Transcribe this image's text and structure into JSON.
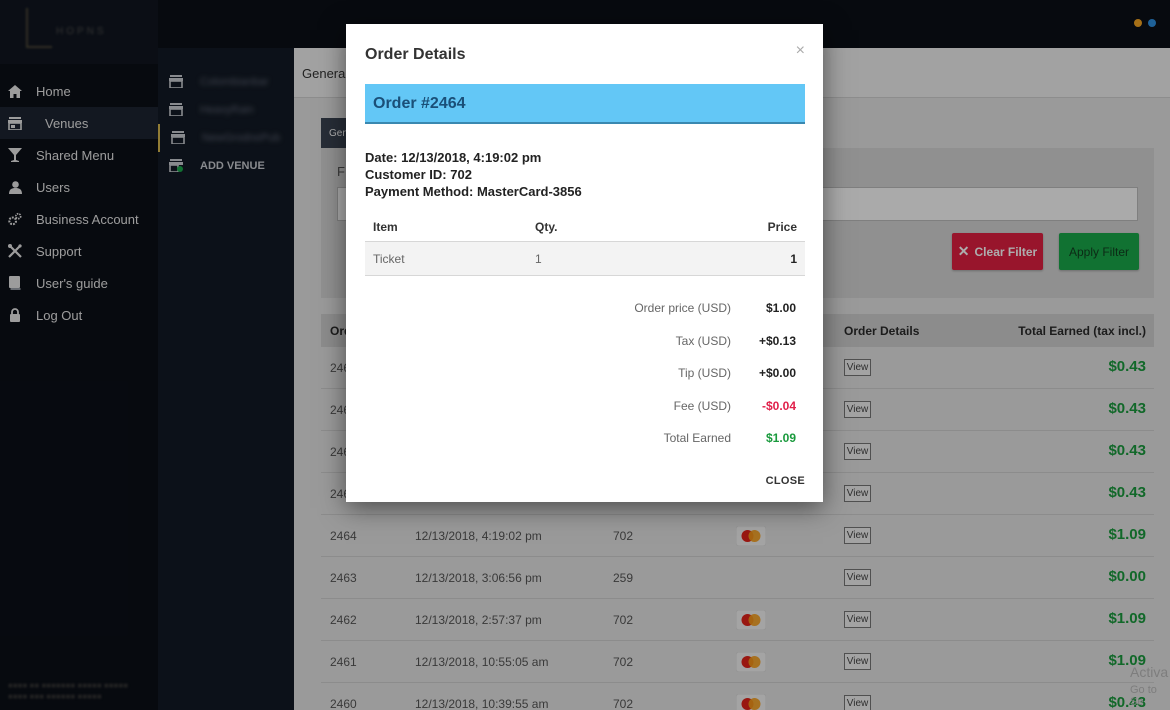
{
  "sidebar": {
    "items": [
      {
        "label": "Home",
        "icon": "home-icon"
      },
      {
        "label": "Venues",
        "icon": "store-icon"
      },
      {
        "label": "Shared Menu",
        "icon": "cocktail-icon"
      },
      {
        "label": "Users",
        "icon": "user-icon"
      },
      {
        "label": "Business Account",
        "icon": "gears-icon"
      },
      {
        "label": "Support",
        "icon": "tools-icon"
      },
      {
        "label": "User's guide",
        "icon": "book-icon"
      },
      {
        "label": "Log Out",
        "icon": "lock-icon"
      }
    ]
  },
  "subnav": {
    "venues": [
      "Colombianbar",
      "HeavyRain",
      "NewGrodnoPub"
    ],
    "add_label": "ADD VENUE"
  },
  "main": {
    "tab_label": "General",
    "tab2_label": "Gen",
    "filter_label": "F",
    "clear_filter_label": "Clear Filter",
    "apply_filter_label": "Apply Filter",
    "table_headers": {
      "order": "Ord",
      "order_details": "Order Details",
      "total_earned": "Total Earned (tax incl.)"
    },
    "rows": [
      {
        "id": "246",
        "date": "",
        "customer": "",
        "mc": false,
        "amount": "$0.43"
      },
      {
        "id": "246",
        "date": "",
        "customer": "",
        "mc": false,
        "amount": "$0.43"
      },
      {
        "id": "246",
        "date": "",
        "customer": "",
        "mc": false,
        "amount": "$0.43"
      },
      {
        "id": "246",
        "date": "",
        "customer": "",
        "mc": false,
        "amount": "$0.43"
      },
      {
        "id": "2464",
        "date": "12/13/2018, 4:19:02 pm",
        "customer": "702",
        "mc": true,
        "amount": "$1.09"
      },
      {
        "id": "2463",
        "date": "12/13/2018, 3:06:56 pm",
        "customer": "259",
        "mc": false,
        "amount": "$0.00"
      },
      {
        "id": "2462",
        "date": "12/13/2018, 2:57:37 pm",
        "customer": "702",
        "mc": true,
        "amount": "$1.09"
      },
      {
        "id": "2461",
        "date": "12/13/2018, 10:55:05 am",
        "customer": "702",
        "mc": true,
        "amount": "$1.09"
      },
      {
        "id": "2460",
        "date": "12/13/2018, 10:39:55 am",
        "customer": "702",
        "mc": true,
        "amount": "$0.43"
      }
    ],
    "view_label": "View",
    "watermark_line1": "Activa",
    "watermark_line2": "Go to Se"
  },
  "modal": {
    "title": "Order Details",
    "close_x": "×",
    "order_number": "Order #2464",
    "date_line": "Date: 12/13/2018, 4:19:02 pm",
    "customer_line": "Customer ID: 702",
    "payment_line": "Payment Method: MasterCard-3856",
    "items_headers": {
      "item": "Item",
      "qty": "Qty.",
      "price": "Price"
    },
    "items": [
      {
        "item": "Ticket",
        "qty": "1",
        "price": "1"
      }
    ],
    "summary": [
      {
        "label": "Order price (USD)",
        "value": "$1.00",
        "color": "#222222"
      },
      {
        "label": "Tax (USD)",
        "value": "+$0.13",
        "color": "#222222"
      },
      {
        "label": "Tip (USD)",
        "value": "+$0.00",
        "color": "#222222"
      },
      {
        "label": "Fee (USD)",
        "value": "-$0.04",
        "color": "#e0204a"
      },
      {
        "label": "Total Earned",
        "value": "$1.09",
        "color": "#1a9a3d"
      }
    ],
    "close_label": "CLOSE"
  },
  "colors": {
    "accent_gold": "#d8b84e",
    "dot_orange": "#f5a623",
    "dot_blue": "#2d8fe0",
    "order_band": "#63c7f6"
  }
}
